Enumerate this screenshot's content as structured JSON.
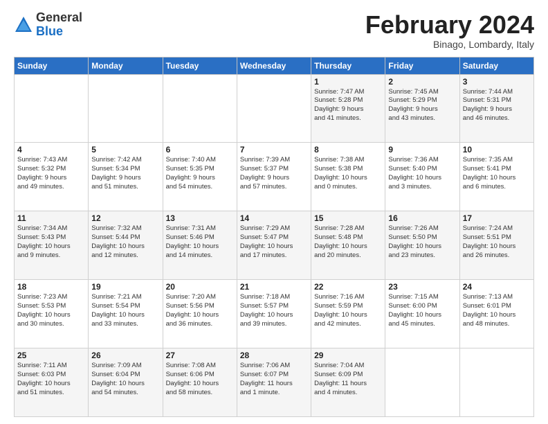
{
  "header": {
    "logo": {
      "general": "General",
      "blue": "Blue"
    },
    "title": "February 2024",
    "subtitle": "Binago, Lombardy, Italy"
  },
  "calendar": {
    "days_of_week": [
      "Sunday",
      "Monday",
      "Tuesday",
      "Wednesday",
      "Thursday",
      "Friday",
      "Saturday"
    ],
    "weeks": [
      [
        {
          "day": "",
          "info": ""
        },
        {
          "day": "",
          "info": ""
        },
        {
          "day": "",
          "info": ""
        },
        {
          "day": "",
          "info": ""
        },
        {
          "day": "1",
          "info": "Sunrise: 7:47 AM\nSunset: 5:28 PM\nDaylight: 9 hours\nand 41 minutes."
        },
        {
          "day": "2",
          "info": "Sunrise: 7:45 AM\nSunset: 5:29 PM\nDaylight: 9 hours\nand 43 minutes."
        },
        {
          "day": "3",
          "info": "Sunrise: 7:44 AM\nSunset: 5:31 PM\nDaylight: 9 hours\nand 46 minutes."
        }
      ],
      [
        {
          "day": "4",
          "info": "Sunrise: 7:43 AM\nSunset: 5:32 PM\nDaylight: 9 hours\nand 49 minutes."
        },
        {
          "day": "5",
          "info": "Sunrise: 7:42 AM\nSunset: 5:34 PM\nDaylight: 9 hours\nand 51 minutes."
        },
        {
          "day": "6",
          "info": "Sunrise: 7:40 AM\nSunset: 5:35 PM\nDaylight: 9 hours\nand 54 minutes."
        },
        {
          "day": "7",
          "info": "Sunrise: 7:39 AM\nSunset: 5:37 PM\nDaylight: 9 hours\nand 57 minutes."
        },
        {
          "day": "8",
          "info": "Sunrise: 7:38 AM\nSunset: 5:38 PM\nDaylight: 10 hours\nand 0 minutes."
        },
        {
          "day": "9",
          "info": "Sunrise: 7:36 AM\nSunset: 5:40 PM\nDaylight: 10 hours\nand 3 minutes."
        },
        {
          "day": "10",
          "info": "Sunrise: 7:35 AM\nSunset: 5:41 PM\nDaylight: 10 hours\nand 6 minutes."
        }
      ],
      [
        {
          "day": "11",
          "info": "Sunrise: 7:34 AM\nSunset: 5:43 PM\nDaylight: 10 hours\nand 9 minutes."
        },
        {
          "day": "12",
          "info": "Sunrise: 7:32 AM\nSunset: 5:44 PM\nDaylight: 10 hours\nand 12 minutes."
        },
        {
          "day": "13",
          "info": "Sunrise: 7:31 AM\nSunset: 5:46 PM\nDaylight: 10 hours\nand 14 minutes."
        },
        {
          "day": "14",
          "info": "Sunrise: 7:29 AM\nSunset: 5:47 PM\nDaylight: 10 hours\nand 17 minutes."
        },
        {
          "day": "15",
          "info": "Sunrise: 7:28 AM\nSunset: 5:48 PM\nDaylight: 10 hours\nand 20 minutes."
        },
        {
          "day": "16",
          "info": "Sunrise: 7:26 AM\nSunset: 5:50 PM\nDaylight: 10 hours\nand 23 minutes."
        },
        {
          "day": "17",
          "info": "Sunrise: 7:24 AM\nSunset: 5:51 PM\nDaylight: 10 hours\nand 26 minutes."
        }
      ],
      [
        {
          "day": "18",
          "info": "Sunrise: 7:23 AM\nSunset: 5:53 PM\nDaylight: 10 hours\nand 30 minutes."
        },
        {
          "day": "19",
          "info": "Sunrise: 7:21 AM\nSunset: 5:54 PM\nDaylight: 10 hours\nand 33 minutes."
        },
        {
          "day": "20",
          "info": "Sunrise: 7:20 AM\nSunset: 5:56 PM\nDaylight: 10 hours\nand 36 minutes."
        },
        {
          "day": "21",
          "info": "Sunrise: 7:18 AM\nSunset: 5:57 PM\nDaylight: 10 hours\nand 39 minutes."
        },
        {
          "day": "22",
          "info": "Sunrise: 7:16 AM\nSunset: 5:59 PM\nDaylight: 10 hours\nand 42 minutes."
        },
        {
          "day": "23",
          "info": "Sunrise: 7:15 AM\nSunset: 6:00 PM\nDaylight: 10 hours\nand 45 minutes."
        },
        {
          "day": "24",
          "info": "Sunrise: 7:13 AM\nSunset: 6:01 PM\nDaylight: 10 hours\nand 48 minutes."
        }
      ],
      [
        {
          "day": "25",
          "info": "Sunrise: 7:11 AM\nSunset: 6:03 PM\nDaylight: 10 hours\nand 51 minutes."
        },
        {
          "day": "26",
          "info": "Sunrise: 7:09 AM\nSunset: 6:04 PM\nDaylight: 10 hours\nand 54 minutes."
        },
        {
          "day": "27",
          "info": "Sunrise: 7:08 AM\nSunset: 6:06 PM\nDaylight: 10 hours\nand 58 minutes."
        },
        {
          "day": "28",
          "info": "Sunrise: 7:06 AM\nSunset: 6:07 PM\nDaylight: 11 hours\nand 1 minute."
        },
        {
          "day": "29",
          "info": "Sunrise: 7:04 AM\nSunset: 6:09 PM\nDaylight: 11 hours\nand 4 minutes."
        },
        {
          "day": "",
          "info": ""
        },
        {
          "day": "",
          "info": ""
        }
      ]
    ]
  }
}
